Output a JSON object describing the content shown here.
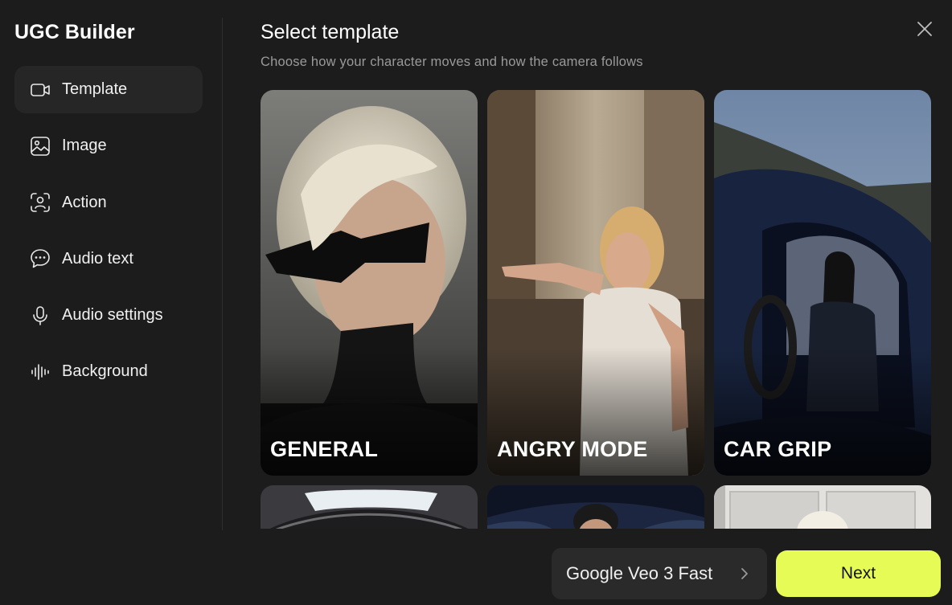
{
  "app": {
    "title": "UGC Builder"
  },
  "sidebar": {
    "items": [
      {
        "label": "Template",
        "icon": "video-icon",
        "active": true
      },
      {
        "label": "Image",
        "icon": "image-icon",
        "active": false
      },
      {
        "label": "Action",
        "icon": "face-scan-icon",
        "active": false
      },
      {
        "label": "Audio text",
        "icon": "chat-bubble-icon",
        "active": false
      },
      {
        "label": "Audio settings",
        "icon": "microphone-icon",
        "active": false
      },
      {
        "label": "Background",
        "icon": "waveform-icon",
        "active": false
      }
    ]
  },
  "main": {
    "title": "Select template",
    "subtitle": "Choose how your character moves and how the camera follows",
    "templates": [
      {
        "label": "GENERAL"
      },
      {
        "label": "ANGRY MODE"
      },
      {
        "label": "CAR GRIP"
      }
    ]
  },
  "footer": {
    "model_label": "Google Veo 3 Fast",
    "next_label": "Next"
  },
  "colors": {
    "background": "#1c1c1c",
    "active_nav": "#262626",
    "accent": "#e6fb56",
    "model_button": "#2a2a2a"
  }
}
